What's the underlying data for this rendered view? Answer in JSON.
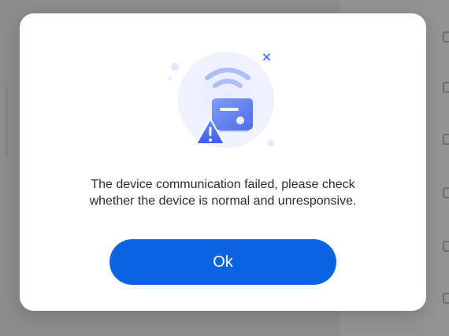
{
  "dialog": {
    "message_line1": "The device communication failed, please check",
    "message_line2": "whether the device is normal and unresponsive.",
    "ok_label": "Ok",
    "illustration_icon": "device-connection-warning-icon"
  },
  "colors": {
    "primary_button": "#0b65e3",
    "overlay": "#8c8c8c",
    "illustration_blue": "#5b7cf2",
    "text": "#2b2b2b"
  }
}
